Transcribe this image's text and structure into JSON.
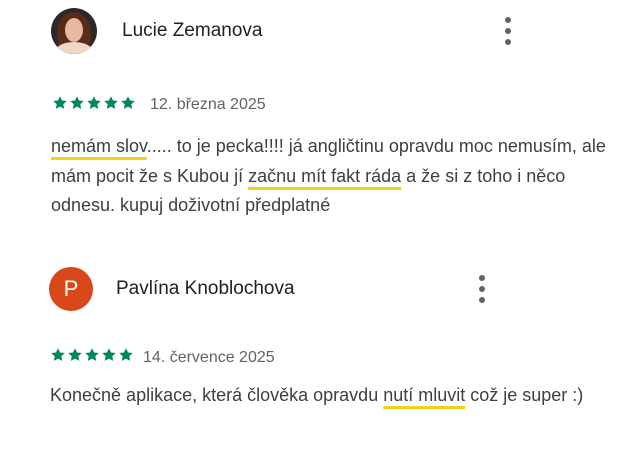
{
  "reviews": [
    {
      "author": "Lucie Zemanova",
      "avatar": "profile-photo",
      "rating": 5,
      "date": "12. března 2025",
      "text_parts": [
        {
          "t": "nemám slov",
          "hl": true
        },
        {
          "t": "..... to je pecka!!!! já angličtinu opravdu moc nemusím, ale mám pocit že s Kubou jí ",
          "hl": false
        },
        {
          "t": "začnu mít fakt ráda",
          "hl": true
        },
        {
          "t": " a že si z toho i něco odnesu. kupuj doživotní předplatné",
          "hl": false
        }
      ]
    },
    {
      "author": "Pavlína Knoblochova",
      "avatar_letter": "P",
      "avatar_color": "#d9481a",
      "rating": 5,
      "date": "14. července 2025",
      "text_parts": [
        {
          "t": "Konečně aplikace, která člověka opravdu ",
          "hl": false
        },
        {
          "t": "nutí mluvit",
          "hl": true
        },
        {
          "t": " což je super :)",
          "hl": false
        }
      ]
    }
  ],
  "colors": {
    "star": "#01875f",
    "highlight": "#f2d21b",
    "avatar_bg": "#d9481a",
    "text": "#3c4043",
    "meta": "#5f6368"
  },
  "icons": {
    "menu": "more-vert-icon",
    "star": "star-icon"
  }
}
